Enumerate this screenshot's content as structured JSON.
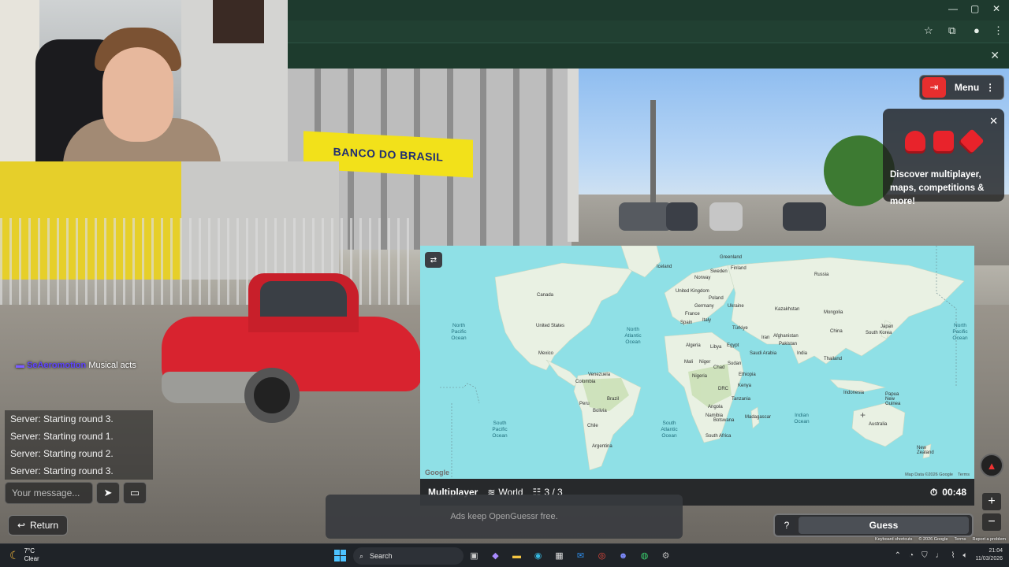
{
  "webcam": {},
  "chat": {
    "username": "SeAeromotion",
    "user_message": "Musical acts",
    "messages": [
      "Server: Starting round 3.",
      "Server: Starting round 1.",
      "Server: Starting round 2.",
      "Server: Starting round 3."
    ],
    "input_placeholder": "Your message...",
    "return_label": "Return"
  },
  "scene": {
    "bank_sign": "BANCO DO BRASIL"
  },
  "menu": {
    "label": "Menu"
  },
  "promo": {
    "text": "Discover multiplayer, maps, competitions & more!"
  },
  "map": {
    "countries": [
      {
        "name": "Greenland"
      },
      {
        "name": "Iceland"
      },
      {
        "name": "Finland"
      },
      {
        "name": "Sweden"
      },
      {
        "name": "Norway"
      },
      {
        "name": "Russia"
      },
      {
        "name": "Canada"
      },
      {
        "name": "United Kingdom"
      },
      {
        "name": "Poland"
      },
      {
        "name": "Germany"
      },
      {
        "name": "Ukraine"
      },
      {
        "name": "France"
      },
      {
        "name": "Kazakhstan"
      },
      {
        "name": "Mongolia"
      },
      {
        "name": "Spain"
      },
      {
        "name": "Italy"
      },
      {
        "name": "Türkiye"
      },
      {
        "name": "United States"
      },
      {
        "name": "Iran"
      },
      {
        "name": "China"
      },
      {
        "name": "Afghanistan"
      },
      {
        "name": "Japan"
      },
      {
        "name": "South Korea"
      },
      {
        "name": "Pakistan"
      },
      {
        "name": "Algeria"
      },
      {
        "name": "Libya"
      },
      {
        "name": "Egypt"
      },
      {
        "name": "Mexico"
      },
      {
        "name": "Saudi Arabia"
      },
      {
        "name": "India"
      },
      {
        "name": "Thailand"
      },
      {
        "name": "Mali"
      },
      {
        "name": "Niger"
      },
      {
        "name": "Chad"
      },
      {
        "name": "Sudan"
      },
      {
        "name": "Venezuela"
      },
      {
        "name": "Colombia"
      },
      {
        "name": "Nigeria"
      },
      {
        "name": "Ethiopia"
      },
      {
        "name": "Kenya"
      },
      {
        "name": "DRC"
      },
      {
        "name": "Indonesia"
      },
      {
        "name": "Papua New Guinea"
      },
      {
        "name": "Peru"
      },
      {
        "name": "Brazil"
      },
      {
        "name": "Bolivia"
      },
      {
        "name": "Tanzania"
      },
      {
        "name": "Angola"
      },
      {
        "name": "Namibia"
      },
      {
        "name": "Botswana"
      },
      {
        "name": "Madagascar"
      },
      {
        "name": "Chile"
      },
      {
        "name": "South Africa"
      },
      {
        "name": "Australia"
      },
      {
        "name": "Argentina"
      },
      {
        "name": "New Zealand"
      }
    ],
    "oceans": [
      {
        "name": "North Pacific Ocean"
      },
      {
        "name": "North Atlantic Ocean"
      },
      {
        "name": "North Pacific Ocean"
      },
      {
        "name": "South Pacific Ocean"
      },
      {
        "name": "South Atlantic Ocean"
      },
      {
        "name": "Indian Ocean"
      }
    ],
    "google": "Google",
    "footer": [
      "Map Data ©2026 Google",
      "Terms"
    ]
  },
  "game_bar": {
    "mode": "Multiplayer",
    "map_name": "World",
    "round": "3 / 3",
    "timer": "00:48"
  },
  "ads": {
    "text": "Ads keep OpenGuessr free."
  },
  "guess": {
    "hint": "?",
    "label": "Guess"
  },
  "streetview_footer": [
    "Keyboard shortcuts",
    "© 2026 Google",
    "Terms",
    "Report a problem"
  ],
  "taskbar": {
    "temp": "7°C",
    "condition": "Clear",
    "search": "Search",
    "time": "21:04",
    "date": "11/03/2026"
  }
}
